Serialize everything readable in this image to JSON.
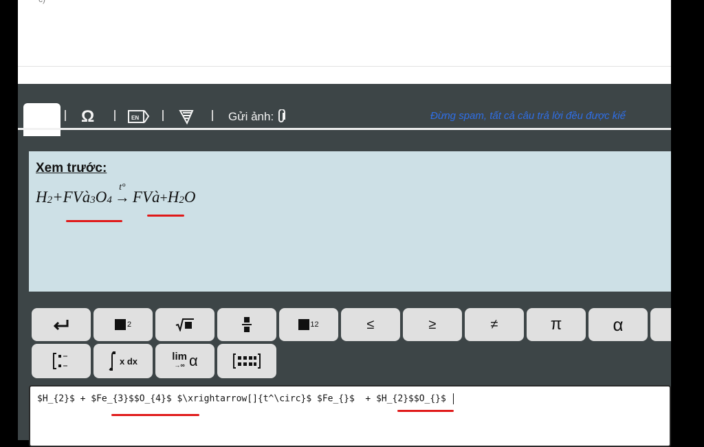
{
  "top": {
    "corner_text": "c)"
  },
  "toolbar": {
    "upload_label": "Gửi ảnh:",
    "notice": "Đừng spam, tất cả câu trả lời đều được kiể"
  },
  "preview": {
    "title": "Xem trước:",
    "formula": {
      "t1": "H",
      "t1_sub": "2",
      "plus1": "+",
      "t2": "FVà",
      "t2_sub": "3",
      "t3": "O",
      "t3_sub": "4",
      "arrow_label": "t°",
      "arrow": "→",
      "t4": "FVà",
      "plus2": " +",
      "t5": "H",
      "t5_sub": "2",
      "t6": "O"
    }
  },
  "keys": {
    "less_equal": "≤",
    "greater_equal": "≥",
    "not_equal": "≠",
    "pi": "π",
    "alpha": "α",
    "superscript": "2",
    "subscript": "12",
    "integral_text": "x dx",
    "limit_text": "lim",
    "limit_sub": "→∞",
    "limit_var": "α"
  },
  "input": {
    "value": "$H_{2}$ + $Fe_{3}$$O_{4}$ $\\xrightarrow[]{t^\\circ}$ $Fe_{}$  + $H_{2}$$O_{}$ "
  }
}
